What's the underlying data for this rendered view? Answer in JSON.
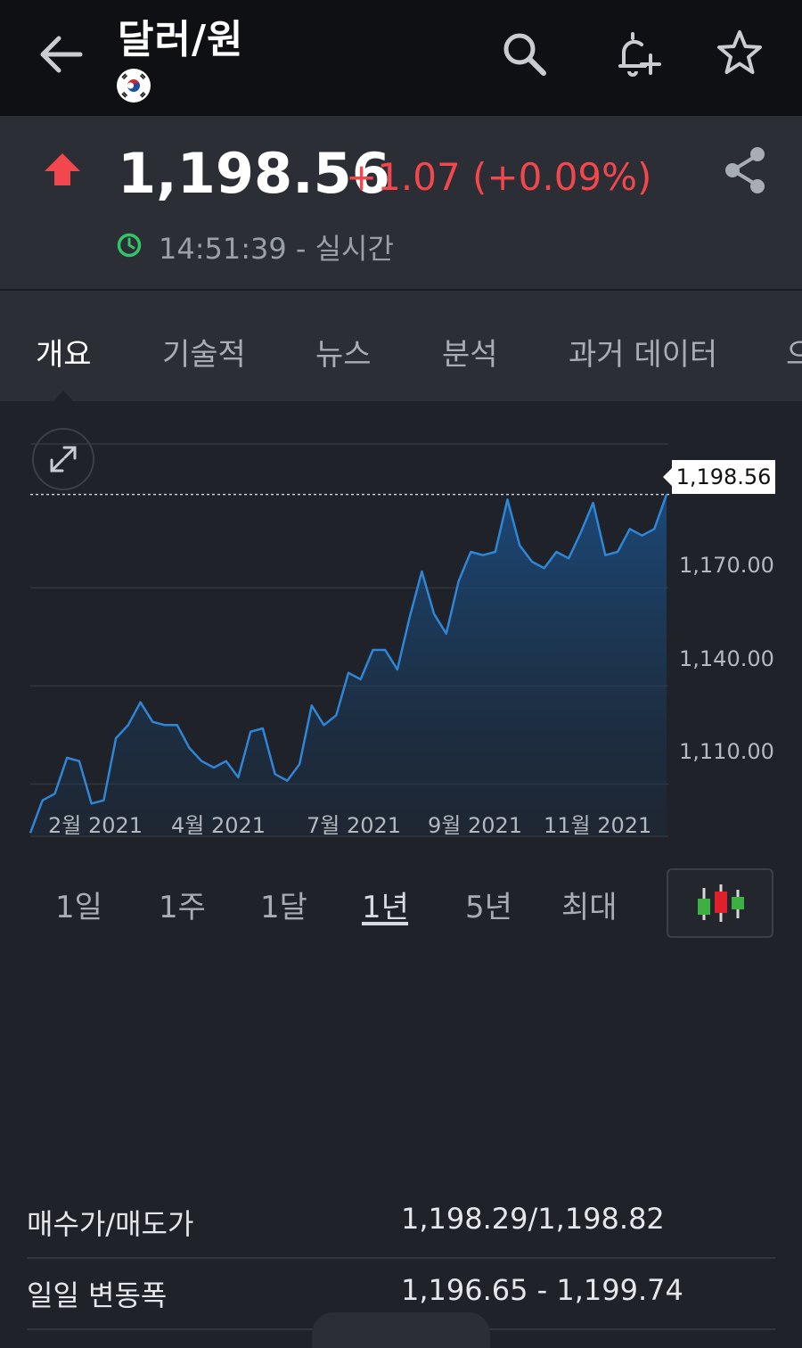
{
  "header": {
    "title": "달러/원",
    "icons": {
      "back": "back-arrow-icon",
      "search": "search-icon",
      "alert": "bell-plus-icon",
      "watchlist": "star-icon",
      "flag": "south-korea-flag-icon"
    }
  },
  "quote": {
    "price": "1,198.56",
    "change": "+1.07 (+0.09%)",
    "direction": "up",
    "time": "14:51:39 - 실시간",
    "colors": {
      "up": "#f2474c",
      "live": "#33c36a"
    }
  },
  "tabs": [
    {
      "label": "개요",
      "active": true
    },
    {
      "label": "기술적",
      "active": false
    },
    {
      "label": "뉴스",
      "active": false
    },
    {
      "label": "분석",
      "active": false
    },
    {
      "label": "과거 데이터",
      "active": false
    },
    {
      "label": "으",
      "active": false
    }
  ],
  "chart_data": {
    "type": "area",
    "title": "",
    "xlabel": "",
    "ylabel": "",
    "x_ticks": [
      "2월 2021",
      "4월 2021",
      "7월 2021",
      "9월 2021",
      "11월 2021"
    ],
    "y_ticks": [
      "1,110.00",
      "1,140.00",
      "1,170.00"
    ],
    "ylim": [
      1094,
      1214
    ],
    "last_value_label": "1,198.56",
    "line_color": "#2f86d6",
    "grid": true,
    "series": [
      {
        "values": [
          1095,
          1105,
          1107,
          1118,
          1117,
          1104,
          1105,
          1124,
          1128,
          1135,
          1129,
          1128,
          1128,
          1121,
          1117,
          1115,
          1117,
          1112,
          1126,
          1127,
          1113,
          1111,
          1116,
          1134,
          1128,
          1131,
          1144,
          1142,
          1151,
          1151,
          1145,
          1161,
          1175,
          1162,
          1156,
          1172,
          1181,
          1180,
          1181,
          1197,
          1183,
          1178,
          1176,
          1181,
          1179,
          1187,
          1196,
          1180,
          1181,
          1188,
          1186,
          1188,
          1198.56
        ]
      }
    ]
  },
  "ranges": [
    {
      "label": "1일",
      "active": false
    },
    {
      "label": "1주",
      "active": false
    },
    {
      "label": "1달",
      "active": false
    },
    {
      "label": "1년",
      "active": true
    },
    {
      "label": "5년",
      "active": false
    },
    {
      "label": "최대",
      "active": false
    }
  ],
  "info": [
    {
      "label": "매수가/매도가",
      "value": "1,198.29/1,198.82"
    },
    {
      "label": "일일 변동폭",
      "value": "1,196.65 - 1,199.74"
    }
  ]
}
